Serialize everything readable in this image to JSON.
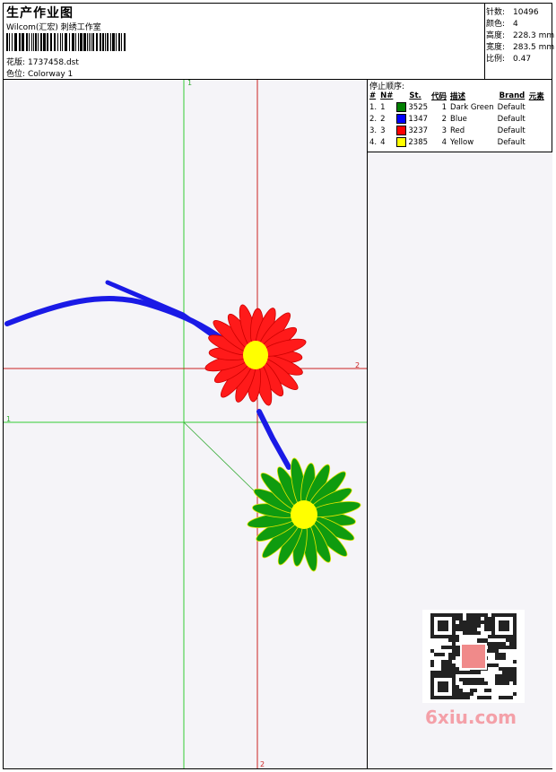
{
  "header": {
    "title": "生产作业图",
    "subtitle": "Wilcom(汇宏) 刺绣工作室",
    "design_label": "花版:",
    "design_value": "1737458.dst",
    "colorway_label": "色位:",
    "colorway_value": "Colorway 1"
  },
  "info": {
    "stitches_label": "针数:",
    "stitches_value": "10496",
    "colors_label": "颜色:",
    "colors_value": "4",
    "height_label": "高度:",
    "height_value": "228.3 mm",
    "width_label": "宽度:",
    "width_value": "283.5 mm",
    "scale_label": "比例:",
    "scale_value": "0.47"
  },
  "stop_sequence": {
    "title": "停止顺序:",
    "headers": [
      "#",
      "N#",
      "St.",
      "代码",
      "描述",
      "Brand",
      "元素"
    ],
    "rows": [
      {
        "idx": "1.",
        "n": "1",
        "st": "3525",
        "code": "1",
        "desc": "Dark Green",
        "brand": "Default",
        "color": "#008000"
      },
      {
        "idx": "2.",
        "n": "2",
        "st": "1347",
        "code": "2",
        "desc": "Blue",
        "brand": "Default",
        "color": "#0000ff"
      },
      {
        "idx": "3.",
        "n": "3",
        "st": "3237",
        "code": "3",
        "desc": "Red",
        "brand": "Default",
        "color": "#ff0000"
      },
      {
        "idx": "4.",
        "n": "4",
        "st": "2385",
        "code": "4",
        "desc": "Yellow",
        "brand": "Default",
        "color": "#ffff00"
      }
    ]
  },
  "guides": {
    "label_1": "1",
    "label_2": "2",
    "label_1b": "1",
    "label_2b": "2"
  },
  "watermark": "6xiu.com"
}
